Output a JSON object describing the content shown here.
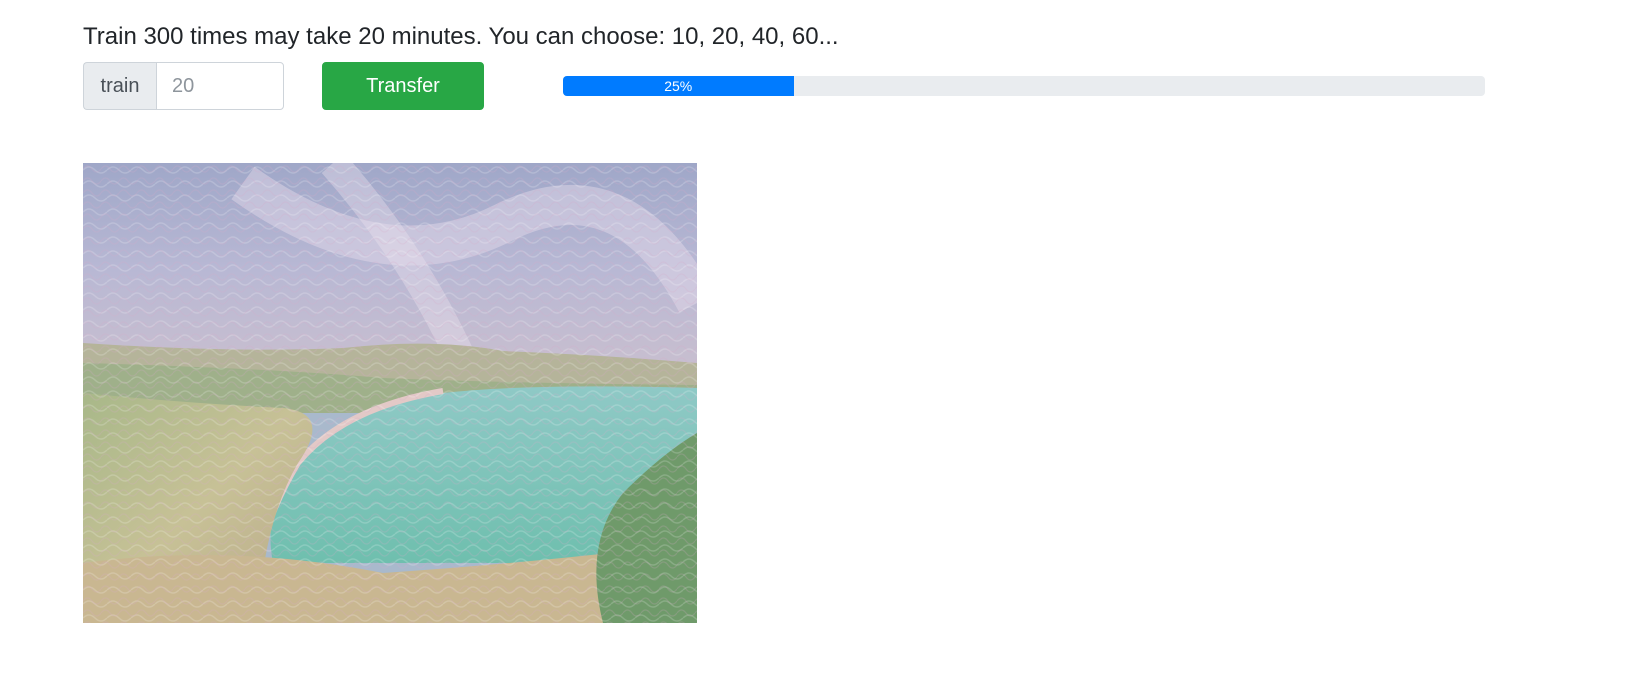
{
  "heading": "Train 300 times may take 20 minutes. You can choose: 10, 20, 40, 60...",
  "train_form": {
    "prepend_label": "train",
    "input_value": "",
    "input_placeholder": "20",
    "transfer_label": "Transfer"
  },
  "progress": {
    "value": 0.25,
    "label": "25%",
    "color": "#007bff",
    "track_color": "#e9ecef"
  },
  "button_color": "#28a745",
  "result_image": {
    "description_icon": "style-transfer-output-image"
  }
}
